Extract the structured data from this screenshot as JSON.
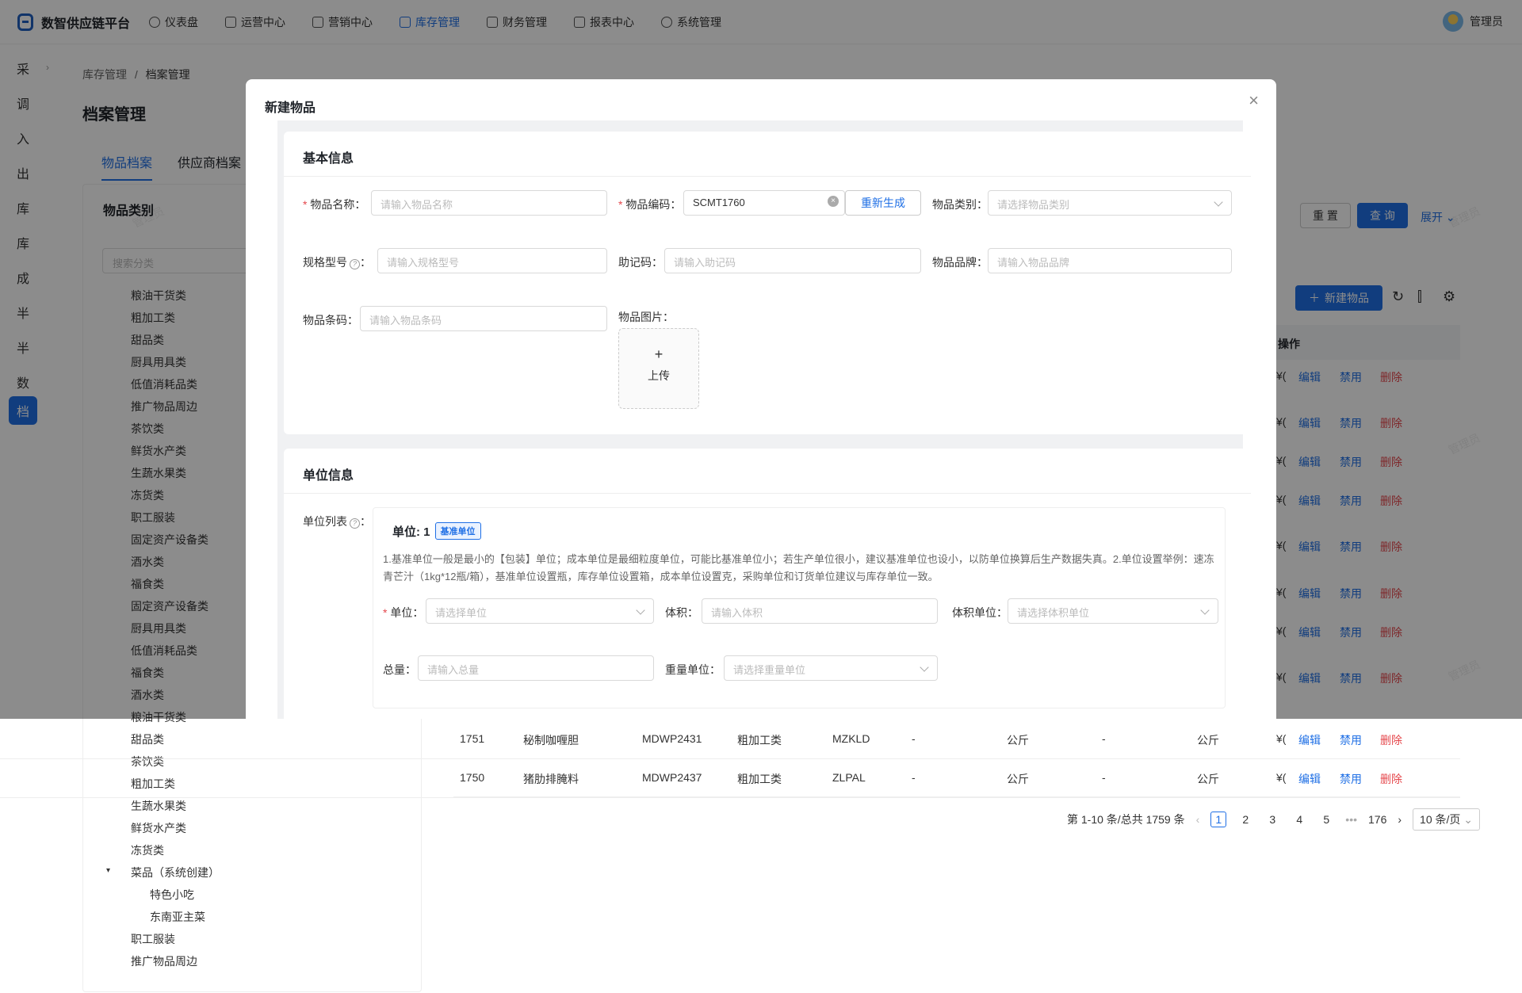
{
  "app": {
    "title": "数智供应链平台",
    "user": "管理员"
  },
  "nav": [
    {
      "label": "仪表盘",
      "icon": "dashboard-icon"
    },
    {
      "label": "运营中心",
      "icon": "operations-icon"
    },
    {
      "label": "营销中心",
      "icon": "marketing-icon"
    },
    {
      "label": "库存管理",
      "icon": "inventory-icon",
      "active": true
    },
    {
      "label": "财务管理",
      "icon": "finance-icon"
    },
    {
      "label": "报表中心",
      "icon": "report-icon"
    },
    {
      "label": "系统管理",
      "icon": "settings-icon"
    }
  ],
  "rail": [
    "采",
    "调",
    "入",
    "出",
    "库",
    "库",
    "成",
    "半",
    "半",
    "数",
    "档"
  ],
  "breadcrumb": {
    "parent": "库存管理",
    "sep": "/",
    "current": "档案管理"
  },
  "page": {
    "title": "档案管理",
    "tabs": [
      "物品档案",
      "供应商档案"
    ]
  },
  "category": {
    "title": "物品类别",
    "search_placeholder": "搜索分类",
    "items_top": [
      "粮油干货类",
      "粗加工类",
      "甜品类",
      "厨具用具类",
      "低值消耗品类",
      "推广物品周边",
      "茶饮类",
      "鲜货水产类",
      "生蔬水果类",
      "冻货类",
      "职工服装",
      "固定资产设备类",
      "酒水类",
      "福食类",
      "固定资产设备类",
      "厨具用具类",
      "低值消耗品类",
      "福食类",
      "酒水类"
    ],
    "items_bottom": [
      "粮油干货类",
      "甜品类",
      "茶饮类",
      "粗加工类",
      "生蔬水果类",
      "鲜货水产类",
      "冻货类"
    ],
    "dish_group": "菜品（系统创建）",
    "dish_children": [
      "特色小吃",
      "东南亚主菜"
    ],
    "items_end": [
      "职工服装",
      "推广物品周边"
    ]
  },
  "toolbar": {
    "reset": "重 置",
    "query": "查 询",
    "expand": "展开",
    "new_item": "新建物品"
  },
  "table": {
    "ops_header": "操作",
    "actions": {
      "edit": "编辑",
      "disable": "禁用",
      "delete": "删除"
    },
    "price_prefix": "¥(",
    "rows": [
      {
        "id": "1751",
        "name": "秘制咖喱胆",
        "code": "MDWP2431",
        "category": "粗加工类",
        "mnemonic": "MZKLD",
        "spec": "-",
        "unit": "公斤",
        "brand": "-",
        "unit2": "公斤"
      },
      {
        "id": "1750",
        "name": "猪肋排腌料",
        "code": "MDWP2437",
        "category": "粗加工类",
        "mnemonic": "ZLPAL",
        "spec": "-",
        "unit": "公斤",
        "brand": "-",
        "unit2": "公斤"
      }
    ]
  },
  "pagination": {
    "summary": "第 1-10 条/总共 1759 条",
    "pages": [
      "1",
      "2",
      "3",
      "4",
      "5"
    ],
    "ellipsis": "•••",
    "last": "176",
    "current": "1",
    "page_size": "10 条/页"
  },
  "watermark": "管理员",
  "modal": {
    "title": "新建物品",
    "basic": {
      "title": "基本信息",
      "name_label": "物品名称：",
      "name_placeholder": "请输入物品名称",
      "code_label": "物品编码：",
      "code_value": "SCMT1760",
      "regenerate": "重新生成",
      "category_label": "物品类别：",
      "category_placeholder": "请选择物品类别",
      "spec_label": "规格型号",
      "spec_placeholder": "请输入规格型号",
      "mnemonic_label": "助记码：",
      "mnemonic_placeholder": "请输入助记码",
      "brand_label": "物品品牌：",
      "brand_placeholder": "请输入物品品牌",
      "barcode_label": "物品条码：",
      "barcode_placeholder": "请输入物品条码",
      "image_label": "物品图片：",
      "upload_plus": "+",
      "upload_label": "上传"
    },
    "unit": {
      "title": "单位信息",
      "list_label": "单位列表",
      "unit_heading": "单位: 1",
      "base_badge": "基准单位",
      "tip": "1.基准单位一般是最小的【包装】单位；成本单位是最细粒度单位，可能比基准单位小；若生产单位很小，建议基准单位也设小，以防单位换算后生产数据失真。2.单位设置举例：速冻青芒汁（1kg*12瓶/箱），基准单位设置瓶，库存单位设置箱，成本单位设置克，采购单位和订货单位建议与库存单位一致。",
      "unit_label": "单位：",
      "unit_placeholder": "请选择单位",
      "volume_label": "体积：",
      "volume_placeholder": "请输入体积",
      "volume_unit_label": "体积单位：",
      "volume_unit_placeholder": "请选择体积单位",
      "weight_label": "总量：",
      "weight_placeholder": "请输入总量",
      "weight_unit_label": "重量单位：",
      "weight_unit_placeholder": "请选择重量单位"
    }
  }
}
